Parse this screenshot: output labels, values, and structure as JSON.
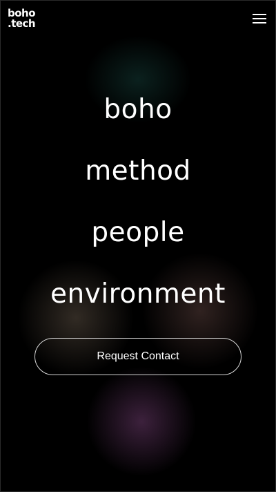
{
  "header": {
    "logo_line1": "boho",
    "logo_line2": ".tech",
    "menu_icon": "hamburger-menu-icon"
  },
  "nav": {
    "items": [
      {
        "label": "boho"
      },
      {
        "label": "method"
      },
      {
        "label": "people"
      },
      {
        "label": "environment"
      }
    ]
  },
  "cta": {
    "label": "Request Contact"
  },
  "colors": {
    "background": "#000000",
    "text": "#ffffff",
    "glow_teal": "#143c37",
    "glow_beige": "#6e5f50",
    "glow_purple": "#6e3c6e"
  }
}
